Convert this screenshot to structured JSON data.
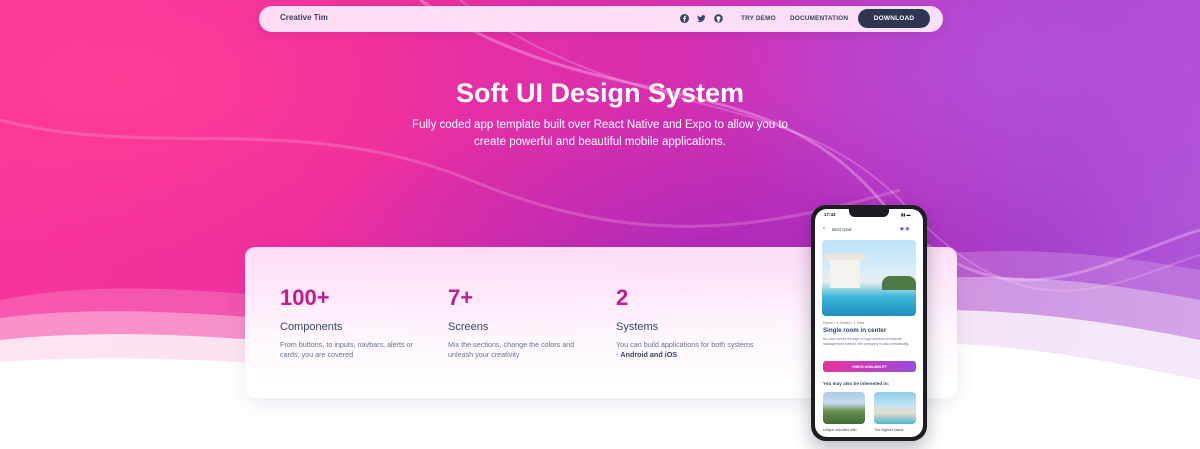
{
  "navbar": {
    "brand": "Creative Tim",
    "social_icons": [
      "facebook-icon",
      "twitter-icon",
      "github-icon"
    ],
    "links": [
      "TRY DEMO",
      "DOCUMENTATION"
    ],
    "download_label": "DOWNLOAD"
  },
  "hero": {
    "title": "Soft UI Design System",
    "subtitle": "Fully coded app template built over React Native and Expo to allow you to create powerful and beautiful mobile applications."
  },
  "stats": [
    {
      "value": "100+",
      "label": "Components",
      "description": "From buttons, to inputs, navbars, alerts or cards, you are covered"
    },
    {
      "value": "7+",
      "label": "Screens",
      "description": "Mix the sections, change the colors and unleash your creativity"
    },
    {
      "value": "2",
      "label": "Systems",
      "description": "You can build applications for both systems - ",
      "description_bold": "Android and iOS"
    }
  ],
  "phone": {
    "time": "17:43",
    "header": "Best Deal",
    "meta": "Room • 1 Guest • 1 Sofa",
    "title": "Single room in center",
    "description": "As Uber works through a huge amount of internal management turmoil, the company is also remarkably.",
    "cta": "CHECK AVAILABILITY",
    "also_title": "You may also be interested in:",
    "thumb1_label": "Unique activities with",
    "thumb2_label": "The highest status"
  },
  "colors": {
    "accent": "#c31a8f",
    "dark": "#344767",
    "button": "#2e3654"
  }
}
